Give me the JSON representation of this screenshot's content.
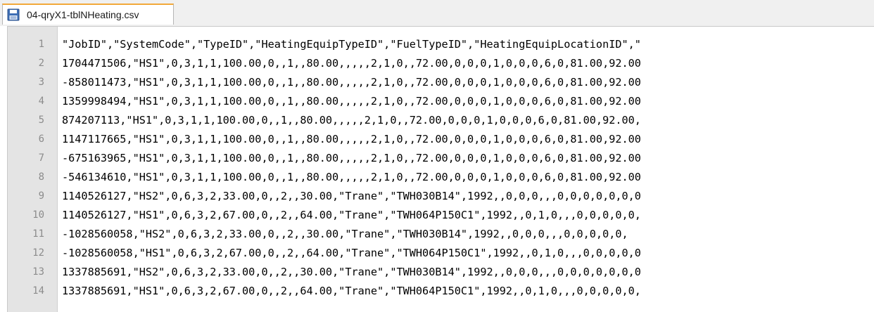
{
  "tab": {
    "title": "04-qryX1-tblNHeating.csv",
    "icon": "save-file-icon"
  },
  "colors": {
    "tab_accent": "#f2a83a",
    "gutter_bg": "#e4e4e4",
    "line_number": "#8c8c8c"
  },
  "lines": [
    {
      "num": "1",
      "text": "\"JobID\",\"SystemCode\",\"TypeID\",\"HeatingEquipTypeID\",\"FuelTypeID\",\"HeatingEquipLocationID\",\""
    },
    {
      "num": "2",
      "text": "1704471506,\"HS1\",0,3,1,1,100.00,0,,1,,80.00,,,,,2,1,0,,72.00,0,0,0,1,0,0,0,6,0,81.00,92.00"
    },
    {
      "num": "3",
      "text": "-858011473,\"HS1\",0,3,1,1,100.00,0,,1,,80.00,,,,,2,1,0,,72.00,0,0,0,1,0,0,0,6,0,81.00,92.00"
    },
    {
      "num": "4",
      "text": "1359998494,\"HS1\",0,3,1,1,100.00,0,,1,,80.00,,,,,2,1,0,,72.00,0,0,0,1,0,0,0,6,0,81.00,92.00"
    },
    {
      "num": "5",
      "text": "874207113,\"HS1\",0,3,1,1,100.00,0,,1,,80.00,,,,,2,1,0,,72.00,0,0,0,1,0,0,0,6,0,81.00,92.00,"
    },
    {
      "num": "6",
      "text": "1147117665,\"HS1\",0,3,1,1,100.00,0,,1,,80.00,,,,,2,1,0,,72.00,0,0,0,1,0,0,0,6,0,81.00,92.00"
    },
    {
      "num": "7",
      "text": "-675163965,\"HS1\",0,3,1,1,100.00,0,,1,,80.00,,,,,2,1,0,,72.00,0,0,0,1,0,0,0,6,0,81.00,92.00"
    },
    {
      "num": "8",
      "text": "-546134610,\"HS1\",0,3,1,1,100.00,0,,1,,80.00,,,,,2,1,0,,72.00,0,0,0,1,0,0,0,6,0,81.00,92.00"
    },
    {
      "num": "9",
      "text": "1140526127,\"HS2\",0,6,3,2,33.00,0,,2,,30.00,\"Trane\",\"TWH030B14\",1992,,0,0,0,,,0,0,0,0,0,0,0"
    },
    {
      "num": "10",
      "text": "1140526127,\"HS1\",0,6,3,2,67.00,0,,2,,64.00,\"Trane\",\"TWH064P150C1\",1992,,0,1,0,,,0,0,0,0,0,"
    },
    {
      "num": "11",
      "text": "-1028560058,\"HS2\",0,6,3,2,33.00,0,,2,,30.00,\"Trane\",\"TWH030B14\",1992,,0,0,0,,,0,0,0,0,0,"
    },
    {
      "num": "12",
      "text": "-1028560058,\"HS1\",0,6,3,2,67.00,0,,2,,64.00,\"Trane\",\"TWH064P150C1\",1992,,0,1,0,,,0,0,0,0,0"
    },
    {
      "num": "13",
      "text": "1337885691,\"HS2\",0,6,3,2,33.00,0,,2,,30.00,\"Trane\",\"TWH030B14\",1992,,0,0,0,,,0,0,0,0,0,0,0"
    },
    {
      "num": "14",
      "text": "1337885691,\"HS1\",0,6,3,2,67.00,0,,2,,64.00,\"Trane\",\"TWH064P150C1\",1992,,0,1,0,,,0,0,0,0,0,"
    }
  ]
}
